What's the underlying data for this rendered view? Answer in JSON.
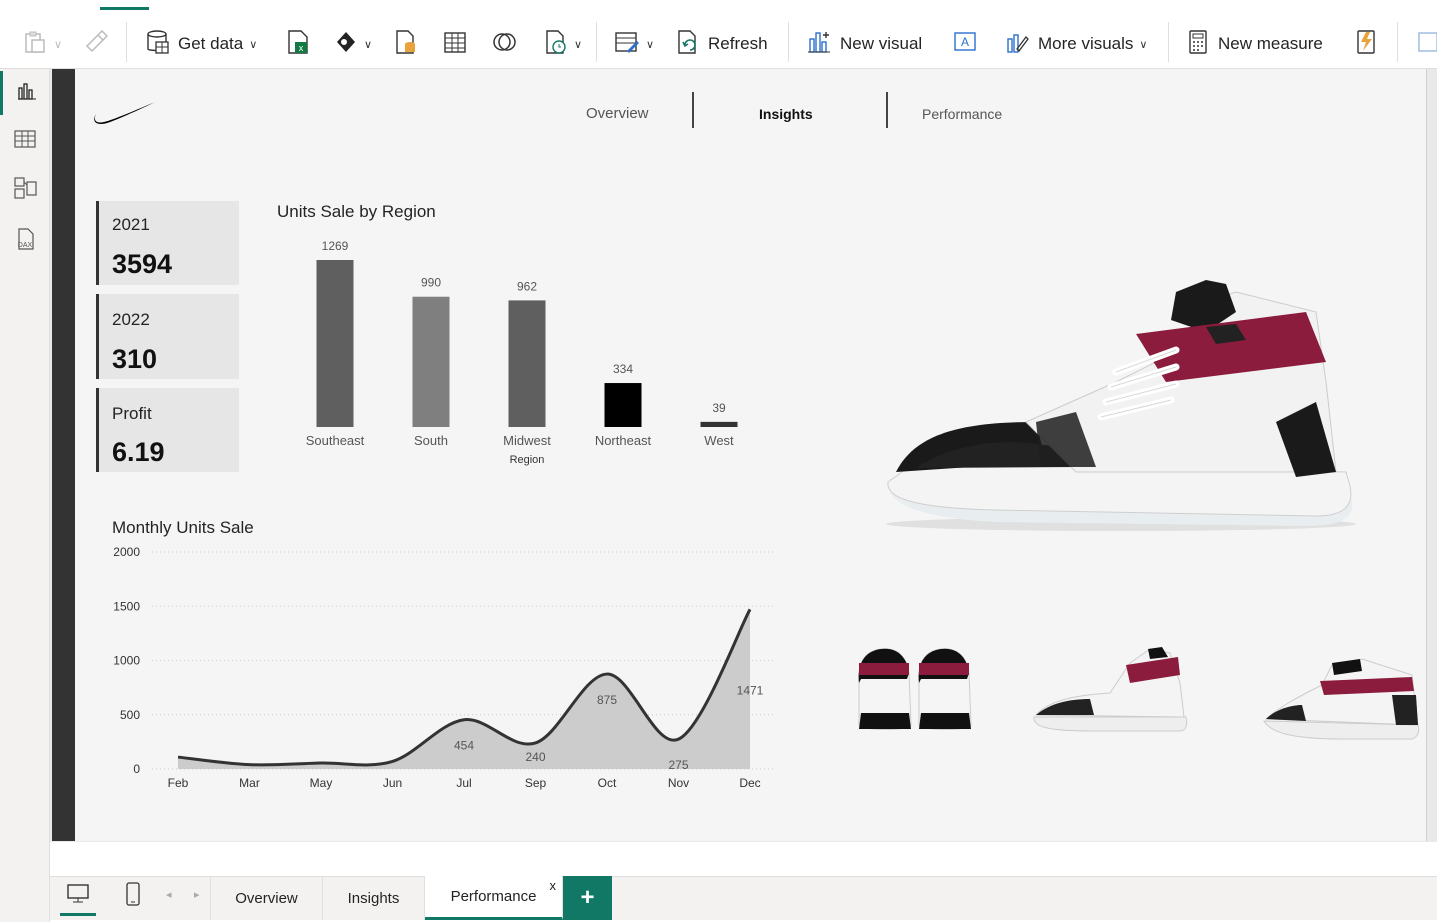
{
  "ribbon": {
    "get_data_label": "Get data",
    "refresh_label": "Refresh",
    "new_visual_label": "New visual",
    "more_visuals_label": "More visuals",
    "new_measure_label": "New measure"
  },
  "report_nav": {
    "items": [
      "Overview",
      "Insights",
      "Performance"
    ]
  },
  "kpi_cards": [
    {
      "label": "2021",
      "value": "3594"
    },
    {
      "label": "2022",
      "value": "310"
    },
    {
      "label": "Profit",
      "value": "6.19"
    }
  ],
  "chart_data": [
    {
      "type": "bar",
      "title": "Units Sale by Region",
      "xlabel": "Region",
      "ylabel": "",
      "categories": [
        "Southeast",
        "South",
        "Midwest",
        "Northeast",
        "West"
      ],
      "values": [
        1269,
        990,
        962,
        334,
        39
      ],
      "colors": [
        "#5f5f5f",
        "#7f7f7f",
        "#5f5f5f",
        "#000000",
        "#333333"
      ],
      "data_labels": true,
      "ylim": [
        0,
        1269
      ]
    },
    {
      "type": "area",
      "title": "Monthly Units Sale",
      "xlabel": "",
      "ylabel": "",
      "categories": [
        "Feb",
        "Mar",
        "May",
        "Jun",
        "Jul",
        "Sep",
        "Oct",
        "Nov",
        "Dec"
      ],
      "values": [
        110,
        40,
        55,
        70,
        454,
        240,
        875,
        275,
        1471
      ],
      "data_labels": [
        "",
        "",
        "",
        "",
        "454",
        "240",
        "875",
        "275",
        "1471"
      ],
      "ylim": [
        0,
        2000
      ],
      "yticks": [
        0,
        500,
        1000,
        1500,
        2000
      ],
      "grid": true,
      "line_color": "#333333",
      "fill_color": "#cccccc"
    }
  ],
  "page_tabs": [
    {
      "label": "Overview"
    },
    {
      "label": "Insights"
    },
    {
      "label": "Performance",
      "active": true
    }
  ],
  "close_label": "x",
  "add_page_label": "+"
}
